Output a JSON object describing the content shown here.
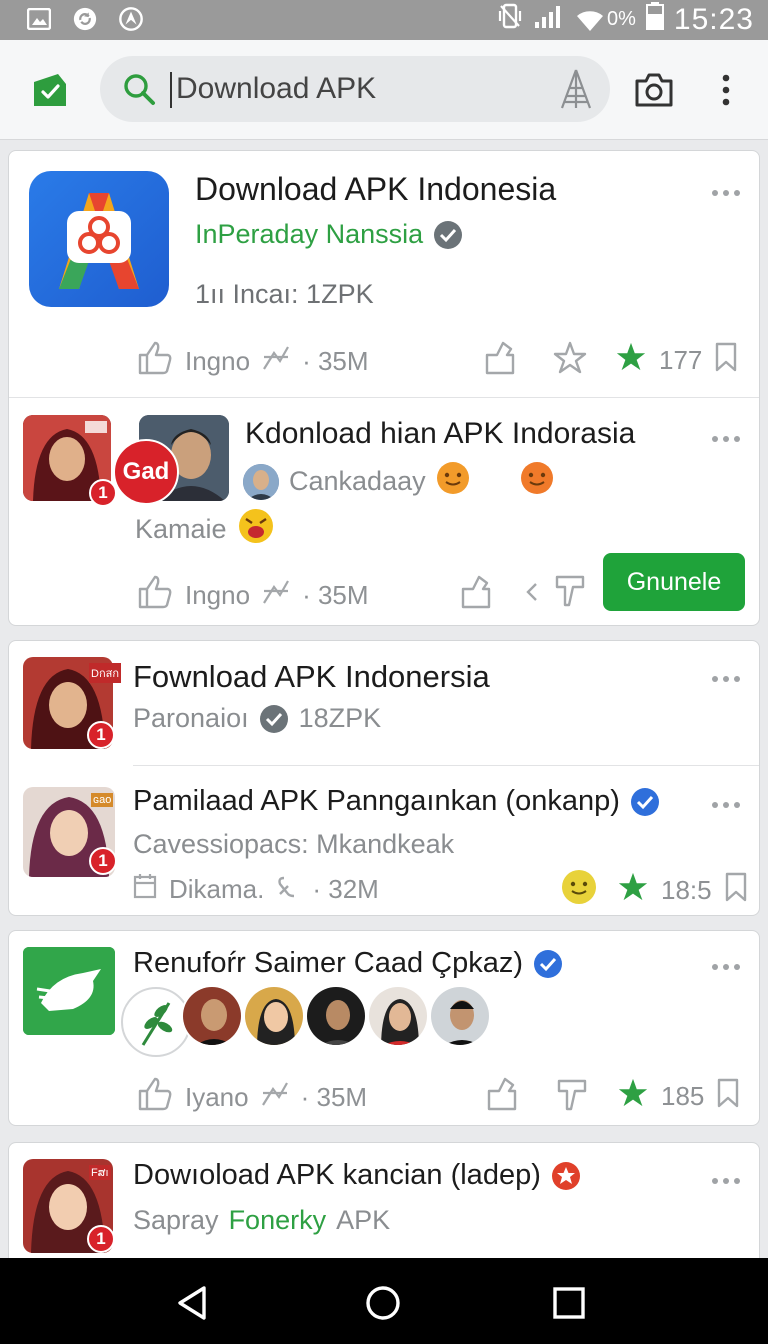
{
  "status": {
    "wifi_pct": "0%",
    "time": "15:23"
  },
  "search": {
    "value": "Download APK"
  },
  "items": [
    {
      "title": "Download APK Indonesia",
      "developer": "InPeraday Nanssia",
      "info": "1ıı  Incaı:  1ZPK",
      "stats_label": "Ingno",
      "stats_size": "· 35M",
      "rating": "177"
    },
    {
      "title": "Kdonload hian APK Indorasia",
      "developer": "Cankadaay",
      "sub2": "Kamaie",
      "badge_text": "Gad",
      "stats_label": "Ingno",
      "stats_size": "· 35M",
      "button": "Gnunele"
    },
    {
      "title": "Fownload APK Indonersia",
      "developer": "Paronaioı",
      "info": "18ZPK",
      "logo_text": "Dกสก"
    },
    {
      "title": "Pamilaad APK Panngaınkan (onkanp)",
      "developer": "Cavessiopacs: Mkandkeak",
      "info": "Dikama.",
      "size": "· 32M",
      "rating": "18:5",
      "logo_text": "ɢao"
    },
    {
      "title": "Renufoŕr Saimer Caad Çpkaz)",
      "stats_label": "Iyano",
      "stats_size": "· 35M",
      "rating": "185"
    },
    {
      "title": "Dowıoload APK kancian (ladep)",
      "developer": "Sapray",
      "developer_green": "Fonerky",
      "suffix": "APK",
      "logo_text": "Fສı"
    }
  ],
  "colors": {
    "accent": "#2ea043",
    "verify_gray": "#6b7378",
    "verify_blue": "#2f6fdb",
    "badge_red": "#d8222a",
    "statusbar": "#9a9a9a"
  },
  "icons": [
    "gallery-icon",
    "sync-icon",
    "compass-icon",
    "vibrate-icon",
    "signal-icon",
    "wifi-icon",
    "battery-icon",
    "app-logo-icon",
    "search-icon",
    "tower-icon",
    "camera-icon",
    "more-icon",
    "like-icon",
    "graph-icon",
    "share-icon",
    "star-icon",
    "bookmark-icon",
    "back-icon",
    "home-icon",
    "recents-icon"
  ]
}
